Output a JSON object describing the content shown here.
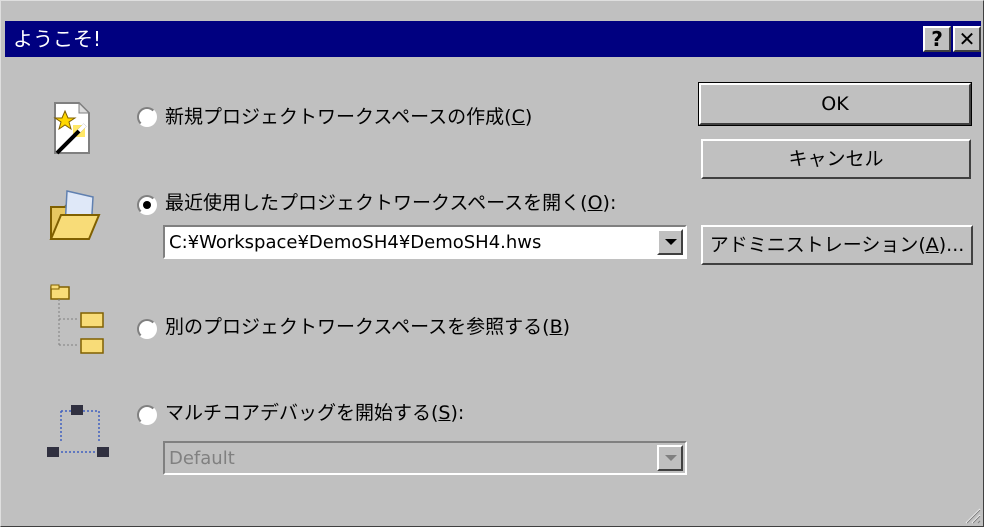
{
  "window": {
    "title": "ようこそ!",
    "help_button": "?",
    "close_button": "✕"
  },
  "options": {
    "new_workspace": {
      "label": "新規プロジェクトワークスペースの作成(",
      "key": "C",
      "suffix": ")",
      "selected": false,
      "icon": "new-workspace-wand-icon"
    },
    "recent_workspace": {
      "label": "最近使用したプロジェクトワークスペースを開く(",
      "key": "O",
      "suffix": "):",
      "selected": true,
      "icon": "open-folder-icon",
      "combo_value": "C:¥Workspace¥DemoSH4¥DemoSH4.hws"
    },
    "browse_workspace": {
      "label": "別のプロジェクトワークスペースを参照する(",
      "key": "B",
      "suffix": ")",
      "selected": false,
      "icon": "folder-tree-icon"
    },
    "multicore_debug": {
      "label": "マルチコアデバッグを開始する(",
      "key": "S",
      "suffix": "):",
      "selected": false,
      "icon": "multicore-network-icon",
      "combo_value": "Default"
    }
  },
  "buttons": {
    "ok": "OK",
    "cancel": "キャンセル",
    "admin_label": "アドミニストレーション(",
    "admin_key": "A",
    "admin_suffix": ")..."
  },
  "colors": {
    "titlebar": "#000080",
    "face": "#c0c0c0"
  }
}
